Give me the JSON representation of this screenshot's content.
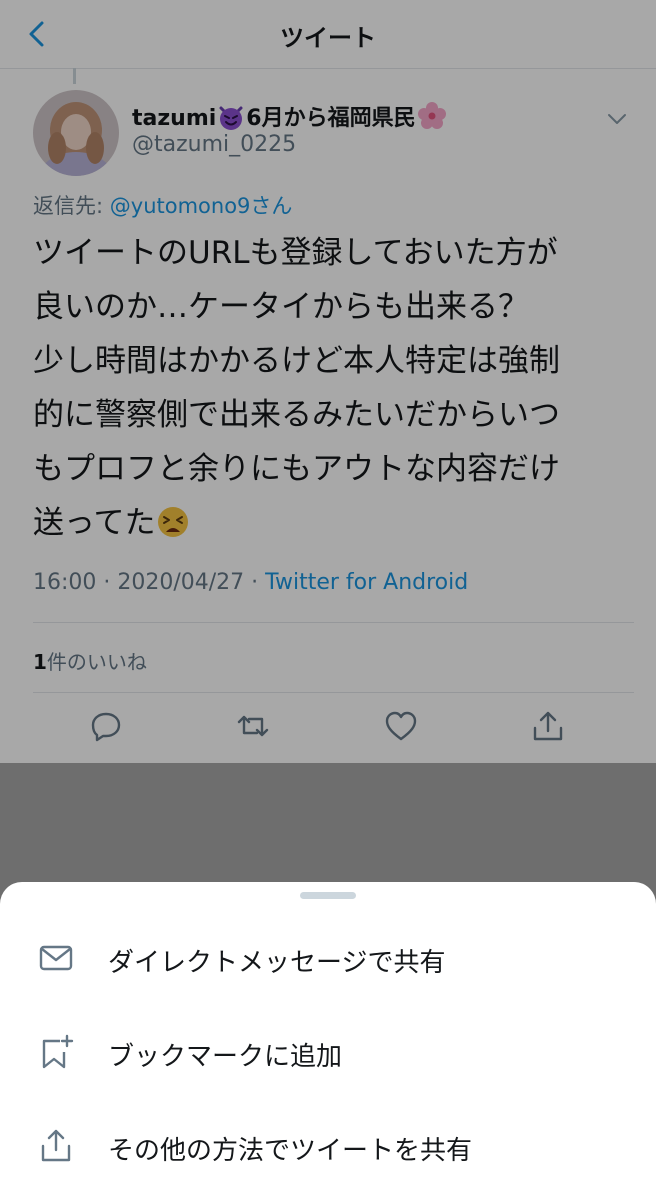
{
  "header": {
    "title": "ツイート"
  },
  "tweet": {
    "display_name_part1": "tazumi",
    "display_name_part2": "6月から福岡県民",
    "handle": "@tazumi_0225",
    "reply_to_label": "返信先: ",
    "reply_to_mention": "@yutomono9さん",
    "text": "ツイートのURLも登録しておいた方が\n良いのか…ケータイからも出来る？\n少し時間はかかるけど本人特定は強制\n的に警察側で出来るみたいだからいつ\nもプロフと余りにもアウトな内容だけ\n送ってた",
    "time": "16:00 · 2020/04/27 · ",
    "source": "Twitter for Android",
    "like_count": "1",
    "like_label": "件のいいね"
  },
  "icons": {
    "back": "chevron-left-icon",
    "more": "chevron-down-icon",
    "reply": "reply-icon",
    "retweet": "retweet-icon",
    "like": "heart-icon",
    "share": "share-icon",
    "name_emoji_1": "smiling-imp-emoji",
    "name_emoji_2": "cherry-blossom-emoji",
    "text_emoji": "tired-face-emoji"
  },
  "share_sheet": {
    "items": [
      {
        "label": "ダイレクトメッセージで共有",
        "icon": "mail-icon"
      },
      {
        "label": "ブックマークに追加",
        "icon": "bookmark-add-icon"
      },
      {
        "label": "その他の方法でツイートを共有",
        "icon": "share-icon"
      }
    ]
  },
  "colors": {
    "accent": "#1b95e0",
    "text": "#14171a",
    "secondary": "#657786",
    "icon": "#657786",
    "overlay": "rgba(0,0,0,0.34)"
  }
}
